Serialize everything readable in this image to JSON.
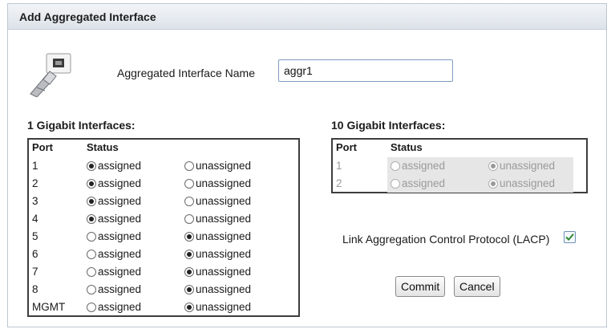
{
  "dialog": {
    "title": "Add Aggregated Interface",
    "icon": "ethernet-cable-icon"
  },
  "name_field": {
    "label": "Aggregated Interface Name",
    "value": "aggr1"
  },
  "gig1": {
    "title": "1 Gigabit Interfaces:",
    "col_port": "Port",
    "col_status": "Status",
    "rows": [
      {
        "port": "1",
        "assigned": "assigned",
        "unassigned": "unassigned",
        "selected": "assigned"
      },
      {
        "port": "2",
        "assigned": "assigned",
        "unassigned": "unassigned",
        "selected": "assigned"
      },
      {
        "port": "3",
        "assigned": "assigned",
        "unassigned": "unassigned",
        "selected": "assigned"
      },
      {
        "port": "4",
        "assigned": "assigned",
        "unassigned": "unassigned",
        "selected": "assigned"
      },
      {
        "port": "5",
        "assigned": "assigned",
        "unassigned": "unassigned",
        "selected": "unassigned"
      },
      {
        "port": "6",
        "assigned": "assigned",
        "unassigned": "unassigned",
        "selected": "unassigned"
      },
      {
        "port": "7",
        "assigned": "assigned",
        "unassigned": "unassigned",
        "selected": "unassigned"
      },
      {
        "port": "8",
        "assigned": "assigned",
        "unassigned": "unassigned",
        "selected": "unassigned"
      },
      {
        "port": "MGMT",
        "assigned": "assigned",
        "unassigned": "unassigned",
        "selected": "unassigned"
      }
    ]
  },
  "gig10": {
    "title": "10 Gigabit Interfaces:",
    "col_port": "Port",
    "col_status": "Status",
    "rows": [
      {
        "port": "1",
        "assigned": "assigned",
        "unassigned": "unassigned",
        "selected": "unassigned",
        "disabled": true
      },
      {
        "port": "2",
        "assigned": "assigned",
        "unassigned": "unassigned",
        "selected": "unassigned",
        "disabled": true
      }
    ]
  },
  "lacp": {
    "label": "Link Aggregation Control Protocol (LACP)",
    "checked": true
  },
  "buttons": {
    "commit": "Commit",
    "cancel": "Cancel"
  },
  "colors": {
    "check_green": "#2f8a2f",
    "input_border": "#7e9bc0"
  }
}
